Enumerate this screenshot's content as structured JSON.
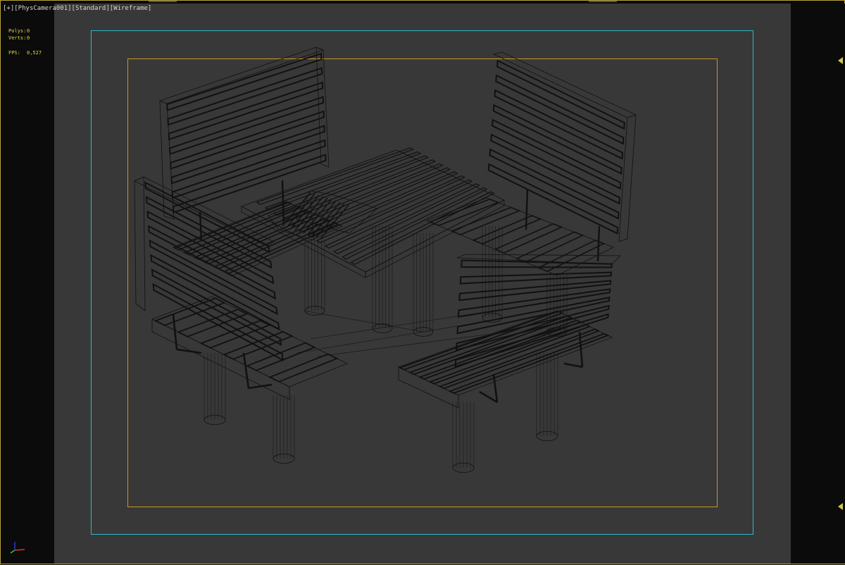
{
  "viewport": {
    "labels": {
      "menu": "[+]",
      "camera": "[PhysCamera001]",
      "shading": "[Standard]",
      "mode": "[Wireframe]"
    },
    "stats": {
      "polys_label": "Polys:",
      "polys_value": "0",
      "verts_label": "Verts:",
      "verts_value": "0",
      "fps_label": "FPS:",
      "fps_value": "0,527"
    },
    "colors": {
      "safe_frame_outer": "#2fb7c8",
      "safe_frame_inner": "#c8962a",
      "viewport_bg": "#383838",
      "wire": "#111111"
    },
    "icons": {
      "axis_gizmo": "axis-tripod-icon",
      "arrow_top": "triangle-left-icon",
      "arrow_bottom": "triangle-left-icon"
    }
  }
}
